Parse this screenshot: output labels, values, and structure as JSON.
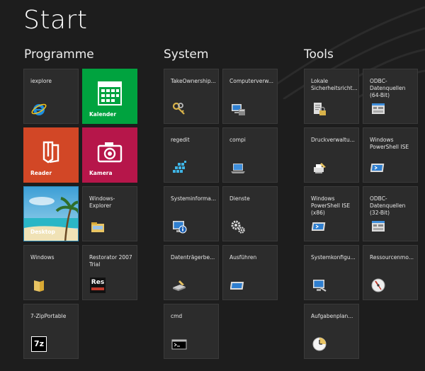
{
  "start": {
    "title": "Start"
  },
  "groups": {
    "programme": "Programme",
    "system": "System",
    "tools": "Tools"
  },
  "tiles": {
    "iexplore": "iexplore",
    "kalender": "Kalender",
    "reader": "Reader",
    "kamera": "Kamera",
    "desktop": "Desktop",
    "windows_explorer": "Windows-\nExplorer",
    "windows": "Windows",
    "restorator": "Restorator 2007\nTrial",
    "sevenzip": "7-ZipPortable",
    "takeownership": "TakeOwnership...",
    "computerverw": "Computerverw...",
    "regedit": "regedit",
    "compi": "compi",
    "systeminforma": "Systeminforma...",
    "dienste": "Dienste",
    "datentraeger": "Datenträgerbe...",
    "ausfuehren": "Ausführen",
    "cmd": "cmd",
    "lokale": "Lokale\nSicherheitsricht...",
    "odbc64": "ODBC-\nDatenquellen\n(64-Bit)",
    "druckverw": "Druckverwaltu...",
    "powershell_ise": "Windows\nPowerShell ISE",
    "powershell_ise_x86": "Windows\nPowerShell ISE\n(x86)",
    "odbc32": "ODBC-\nDatenquellen\n(32-Bit)",
    "systemkonfig": "Systemkonfigu...",
    "ressourcenmo": "Ressourcenmo...",
    "aufgabenplan": "Aufgabenplan..."
  },
  "icon_text": {
    "restorator": "Res",
    "sevenzip": "7z"
  },
  "colors": {
    "background": "#1d1d1d",
    "tile": "#2c2c2c",
    "kalender": "#00a33f",
    "reader": "#d24726",
    "kamera": "#b6164a"
  }
}
